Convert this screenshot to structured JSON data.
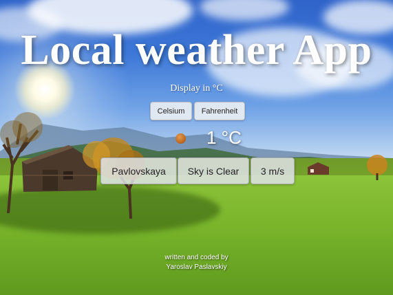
{
  "app": {
    "title": "Local weather App",
    "display_label": "Display in °C"
  },
  "units": {
    "celsius_label": "Celsium",
    "fahrenheit_label": "Fahrenheit"
  },
  "weather": {
    "icon": "sun-icon",
    "temperature": "1 °C",
    "location": "Pavlovskaya",
    "condition": "Sky is Clear",
    "wind": "3 m/s"
  },
  "footer": {
    "line1": "written and coded by",
    "line2": "Yaroslav Paslavskiy"
  }
}
